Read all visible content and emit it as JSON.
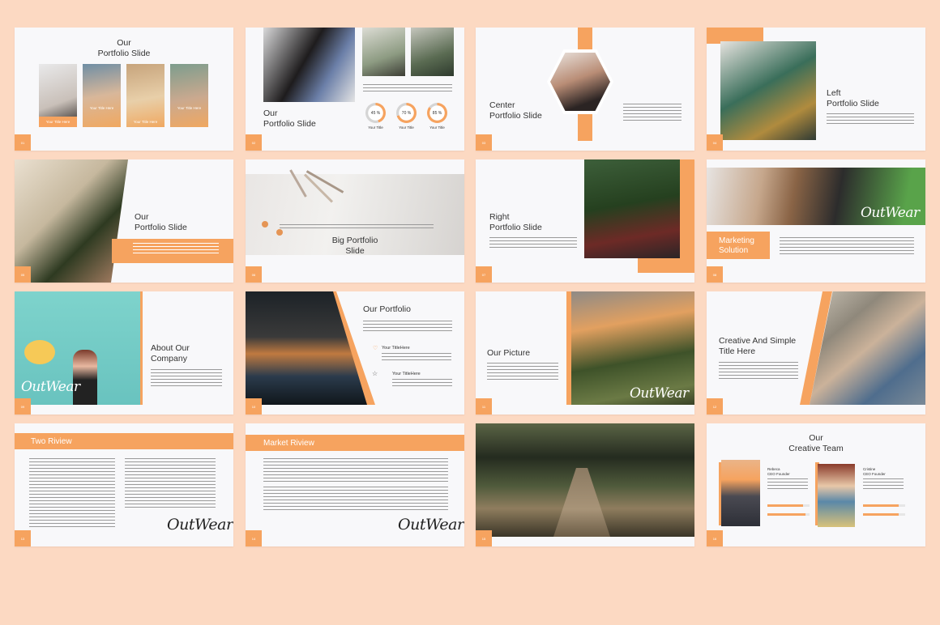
{
  "slides": [
    {
      "num": "01",
      "title": "Our\nPortfolio Slide",
      "cards": [
        "Your Title Here",
        "Your Title Here",
        "Your Title Here",
        "Your Title Here"
      ]
    },
    {
      "num": "02",
      "title": "Our\nPortfolio Slide",
      "stats": [
        {
          "value": "45 %",
          "label": "Your Title",
          "pct": 0.45
        },
        {
          "value": "70 %",
          "label": "Your Title",
          "pct": 0.7
        },
        {
          "value": "85 %",
          "label": "Your Title",
          "pct": 0.85
        }
      ]
    },
    {
      "num": "03",
      "title": "Center\nPortfolio Slide"
    },
    {
      "num": "04",
      "title": "Left\nPortfolio Slide"
    },
    {
      "num": "05",
      "title": "Our\nPortfolio Slide"
    },
    {
      "num": "06",
      "title": "Big Portfolio\nSlide"
    },
    {
      "num": "07",
      "title": "Right\nPortfolio Slide"
    },
    {
      "num": "08",
      "title": "Marketing\nSolution",
      "script": "OutWear"
    },
    {
      "num": "09",
      "title": "About Our\nCompany",
      "script": "OutWear"
    },
    {
      "num": "10",
      "title": "Our Portfolio",
      "items": [
        "Your TitleHere",
        "Your TitleHere"
      ]
    },
    {
      "num": "11",
      "title": "Our Picture",
      "script": "OutWear"
    },
    {
      "num": "12",
      "title": "Creative And Simple\nTitle Here"
    },
    {
      "num": "13",
      "title": "Two Riview",
      "script": "OutWear"
    },
    {
      "num": "14",
      "title": "Market Riview",
      "script": "OutWear"
    },
    {
      "num": "15"
    },
    {
      "num": "16",
      "title": "Our\nCreative Team",
      "members": [
        {
          "name": "Rebeca",
          "role": "CEO Founder",
          "skills": [
            0.85,
            0.9
          ]
        },
        {
          "name": "Cristine",
          "role": "CEO Founder",
          "skills": [
            0.85,
            0.85
          ]
        }
      ]
    }
  ],
  "colors": {
    "accent": "#f6a35f",
    "background": "#fcd9c2",
    "slide": "#f8f8fa"
  }
}
